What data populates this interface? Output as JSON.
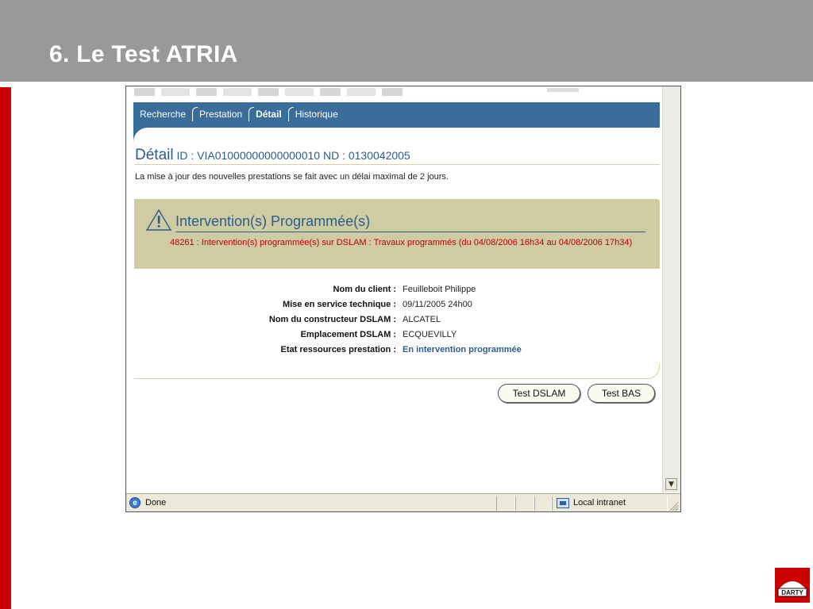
{
  "slide": {
    "title": "6. Le Test ATRIA",
    "brand": "DARTY"
  },
  "nav": {
    "tabs": [
      {
        "label": "Recherche",
        "active": false
      },
      {
        "label": "Prestation",
        "active": false
      },
      {
        "label": "Détail",
        "active": true
      },
      {
        "label": "Historique",
        "active": false
      }
    ]
  },
  "detail": {
    "title_big": "Détail",
    "title_rest": " ID : VIA01000000000000010 ND : 0130042005",
    "info": "La mise à jour des nouvelles prestations se fait avec un délai maximal de 2 jours."
  },
  "alert": {
    "icon": "warning-triangle-icon",
    "heading": "Intervention(s) Programmée(s)",
    "message": "48261 : Intervention(s) programmée(s) sur DSLAM : Travaux programmés (du 04/08/2006 16h34 au 04/08/2006 17h34)"
  },
  "fields": [
    {
      "label": "Nom du client :",
      "value": "Feuilleboit Philippe"
    },
    {
      "label": "Mise en service technique :",
      "value": "09/11/2005 24h00"
    },
    {
      "label": "Nom du constructeur DSLAM :",
      "value": "ALCATEL"
    },
    {
      "label": "Emplacement DSLAM :",
      "value": "ECQUEVILLY"
    },
    {
      "label": "Etat ressources prestation :",
      "value": "En intervention programmée"
    }
  ],
  "buttons": {
    "test_dslam": "Test DSLAM",
    "test_bas": "Test BAS"
  },
  "statusbar": {
    "status": "Done",
    "zone": "Local intranet"
  },
  "colors": {
    "nav_blue": "#3a6d9a",
    "alert_bg": "#cfcba3",
    "alert_text": "#c00000",
    "header_gray": "#999999",
    "accent_red": "#cc0000"
  }
}
